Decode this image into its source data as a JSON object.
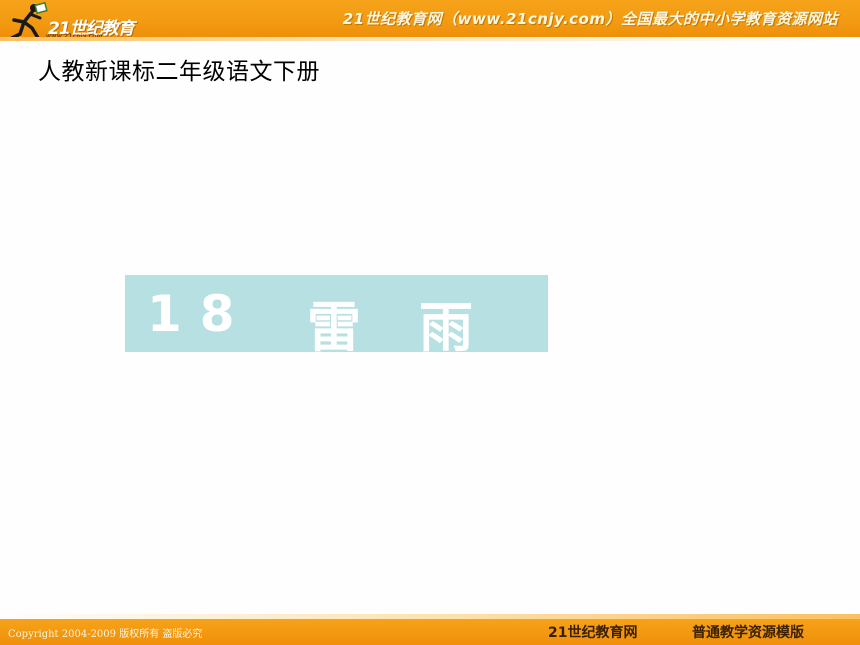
{
  "header": {
    "logo_brand": "21世纪教育",
    "logo_url": "www.21cnjy.com",
    "slogan": "21世纪教育网（www.21cnjy.com）全国最大的中小学教育资源网站"
  },
  "slide": {
    "subtitle": "人教新课标二年级语文下册",
    "lesson_number": "18",
    "lesson_title": "雷雨"
  },
  "footer": {
    "copyright": "Copyright 2004-2009 版权所有 盗版必究",
    "brand": "21世纪教育网",
    "tagline": "普通教学资源模版"
  },
  "colors": {
    "header_orange": "#f29a12",
    "title_box": "#b7e0e2",
    "background": "#fefefe"
  }
}
